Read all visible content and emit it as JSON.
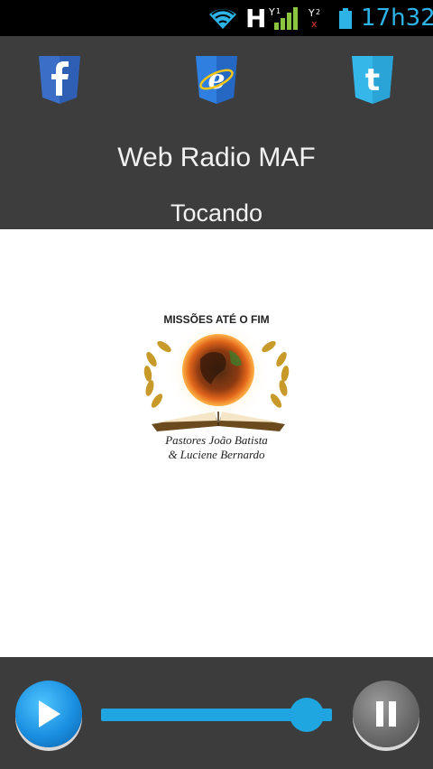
{
  "status_bar": {
    "network_type": "H",
    "time": "17h32",
    "icons": [
      "wifi-icon",
      "signal-icon",
      "signal-no-service-icon",
      "battery-icon"
    ]
  },
  "header": {
    "social": [
      {
        "name": "facebook",
        "icon": "facebook-icon",
        "color": "#3b6fc7"
      },
      {
        "name": "internet-explorer",
        "icon": "internet-explorer-icon",
        "color": "#2f7fe0"
      },
      {
        "name": "twitter",
        "icon": "twitter-icon",
        "color": "#35b7ea"
      }
    ],
    "title": "Web Radio MAF",
    "status": "Tocando"
  },
  "main": {
    "logo": {
      "icon": "missoes-ate-o-fim-logo",
      "top_text": "MISSÕES ATÉ O FIM",
      "bottom_text_line1": "Pastores João Batista",
      "bottom_text_line2": "& Luciene Bernardo"
    }
  },
  "player": {
    "play_icon": "play-icon",
    "pause_icon": "pause-icon",
    "volume_level": 0.89,
    "accent_color": "#1fa6e0"
  }
}
